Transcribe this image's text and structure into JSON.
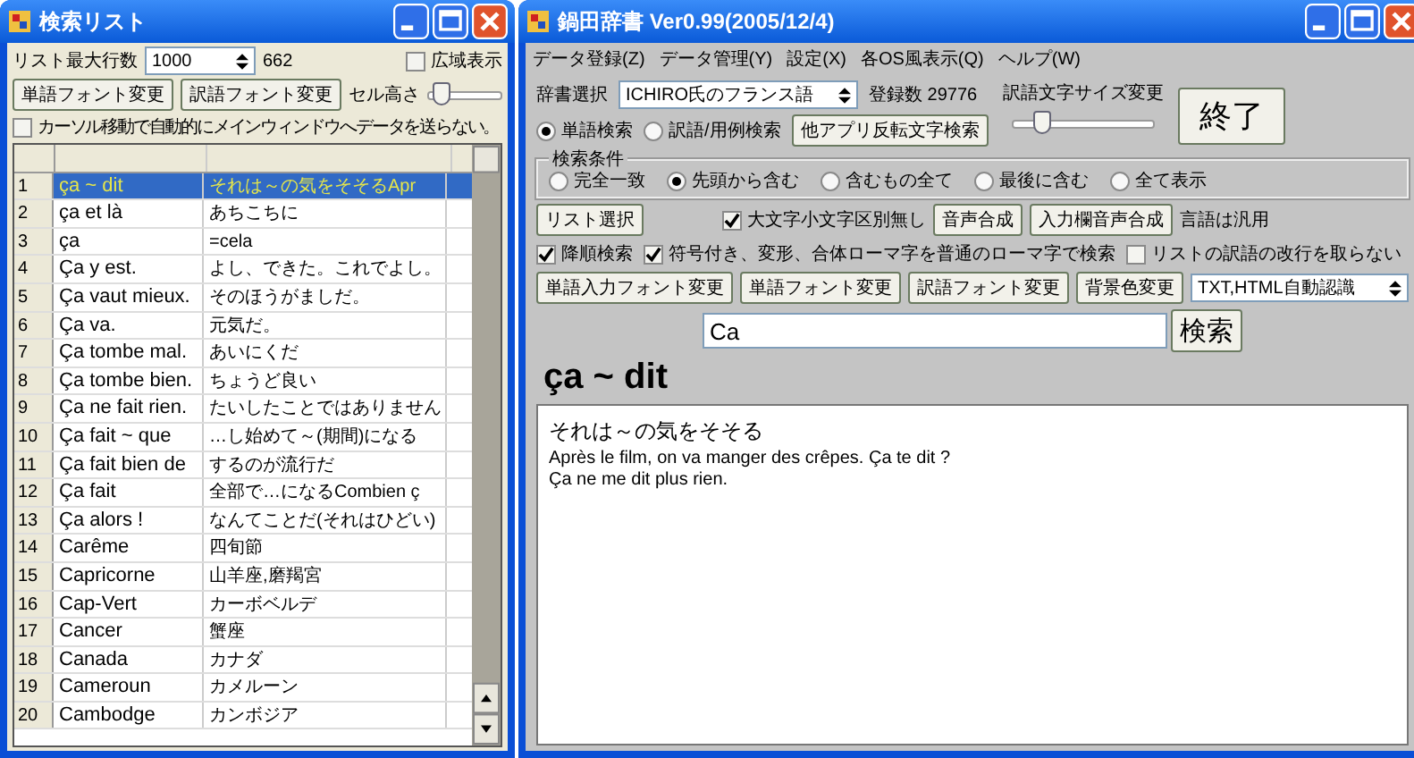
{
  "search_list_window": {
    "title": "検索リスト",
    "max_rows_label": "リスト最大行数",
    "max_rows_value": "1000",
    "count": "662",
    "wide_view": {
      "label": "広域表示",
      "checked": false
    },
    "buttons": [
      "単語フォント変更",
      "訳語フォント変更"
    ],
    "cell_height": {
      "label": "セル高さ",
      "level": 0.08
    },
    "no_auto_send": {
      "label": "カーソル移動で自動的にメインウィンドウへデータを送らない。",
      "checked": false
    },
    "rows": [
      {
        "number": "1",
        "word": "ça ~ dit",
        "translation": "それは～の気をそそるApr",
        "selected": true
      },
      {
        "number": "2",
        "word": "ça et là",
        "translation": "あちこちに",
        "selected": false
      },
      {
        "number": "3",
        "word": "ça",
        "translation": "=cela",
        "selected": false
      },
      {
        "number": "4",
        "word": "Ça y est.",
        "translation": "よし、できた。これでよし。",
        "selected": false
      },
      {
        "number": "5",
        "word": "Ça vaut mieux.",
        "translation": "そのほうがましだ。",
        "selected": false
      },
      {
        "number": "6",
        "word": "Ça va.",
        "translation": "元気だ。",
        "selected": false
      },
      {
        "number": "7",
        "word": "Ça tombe mal.",
        "translation": "あいにくだ",
        "selected": false
      },
      {
        "number": "8",
        "word": "Ça tombe bien.",
        "translation": "ちょうど良い",
        "selected": false
      },
      {
        "number": "9",
        "word": "Ça ne fait rien.",
        "translation": "たいしたことではありません",
        "selected": false
      },
      {
        "number": "10",
        "word": "Ça fait ~ que",
        "translation": "…し始めて～(期間)になる",
        "selected": false
      },
      {
        "number": "11",
        "word": "Ça fait bien de",
        "translation": "するのが流行だ",
        "selected": false
      },
      {
        "number": "12",
        "word": "Ça fait",
        "translation": "全部で…になるCombien ç",
        "selected": false
      },
      {
        "number": "13",
        "word": "Ça alors !",
        "translation": "なんてことだ(それはひどい)",
        "selected": false
      },
      {
        "number": "14",
        "word": "Carême",
        "translation": "四旬節",
        "selected": false
      },
      {
        "number": "15",
        "word": "Capricorne",
        "translation": "山羊座,磨羯宮",
        "selected": false
      },
      {
        "number": "16",
        "word": "Cap-Vert",
        "translation": "カーボベルデ",
        "selected": false
      },
      {
        "number": "17",
        "word": "Cancer",
        "translation": "蟹座",
        "selected": false
      },
      {
        "number": "18",
        "word": "Canada",
        "translation": "カナダ",
        "selected": false
      },
      {
        "number": "19",
        "word": "Cameroun",
        "translation": "カメルーン",
        "selected": false
      },
      {
        "number": "20",
        "word": "Cambodge",
        "translation": "カンボジア",
        "selected": false
      }
    ]
  },
  "main_window": {
    "title": "鍋田辞書 Ver0.99(2005/12/4)",
    "menu": [
      "データ登録(Z)",
      "データ管理(Y)",
      "設定(X)",
      "各OS風表示(Q)",
      "ヘルプ(W)"
    ],
    "dictionary": {
      "label": "辞書選択",
      "value": "ICHIRO氏のフランス語"
    },
    "entry_count": "登録数 29776",
    "font_size": {
      "label": "訳語文字サイズ変更",
      "level": 0.15
    },
    "exit_button": "終了",
    "search_modes": [
      {
        "label": "単語検索",
        "selected": true
      },
      {
        "label": "訳語/用例検索",
        "selected": false
      }
    ],
    "reverse_search_button": "他アプリ反転文字検索",
    "conditions": {
      "title": "検索条件",
      "options": [
        {
          "label": "完全一致",
          "selected": false
        },
        {
          "label": "先頭から含む",
          "selected": true
        },
        {
          "label": "含むもの全て",
          "selected": false
        },
        {
          "label": "最後に含む",
          "selected": false
        },
        {
          "label": "全て表示",
          "selected": false
        }
      ]
    },
    "list_select_button": "リスト選択",
    "case_insensitive": {
      "label": "大文字小文字区別無し",
      "checked": true
    },
    "speech_buttons": [
      "音声合成",
      "入力欄音声合成"
    ],
    "language_note": "言語は汎用",
    "options": [
      {
        "label": "降順検索",
        "checked": true
      },
      {
        "label": "符号付き、変形、合体ローマ字を普通のローマ字で検索",
        "checked": true
      },
      {
        "label": "リストの訳語の改行を取らない",
        "checked": false
      }
    ],
    "font_buttons": [
      "単語入力フォント変更",
      "単語フォント変更",
      "訳語フォント変更",
      "背景色変更"
    ],
    "format_select": "TXT,HTML自動認識",
    "search_input": {
      "value": "Ca"
    },
    "search_button": "検索",
    "headword": "ça ~ dit",
    "result_lines": [
      "それは～の気をそそる",
      "Après le film, on va manger des crêpes. Ça te dit ?",
      "Ça ne me dit plus rien."
    ]
  }
}
